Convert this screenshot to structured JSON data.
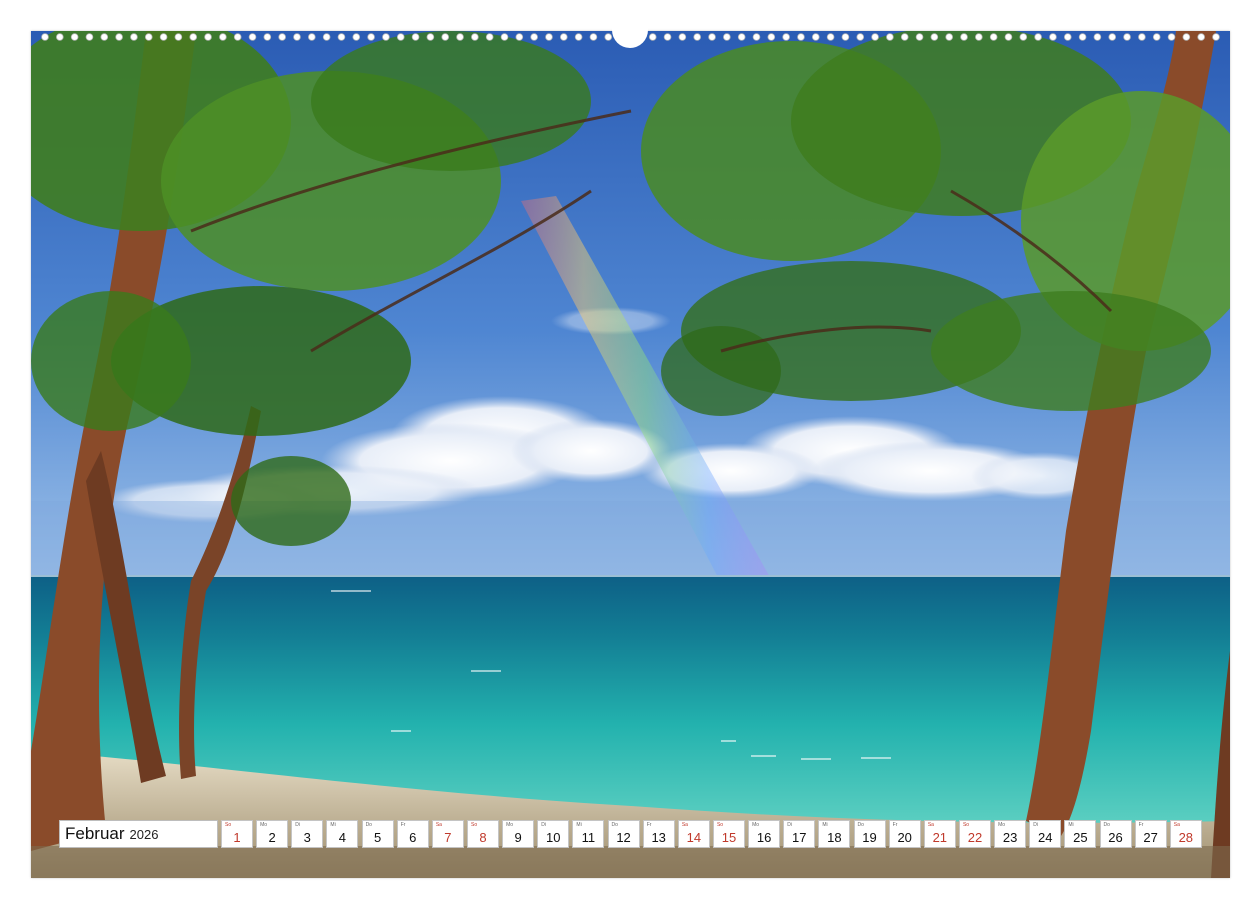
{
  "calendar": {
    "month": "Februar",
    "year": "2026",
    "weekend_color": "#c0392b",
    "days": [
      {
        "abbr": "So",
        "num": "1",
        "weekend": true
      },
      {
        "abbr": "Mo",
        "num": "2",
        "weekend": false
      },
      {
        "abbr": "Di",
        "num": "3",
        "weekend": false
      },
      {
        "abbr": "Mi",
        "num": "4",
        "weekend": false
      },
      {
        "abbr": "Do",
        "num": "5",
        "weekend": false
      },
      {
        "abbr": "Fr",
        "num": "6",
        "weekend": false
      },
      {
        "abbr": "Sa",
        "num": "7",
        "weekend": true
      },
      {
        "abbr": "So",
        "num": "8",
        "weekend": true
      },
      {
        "abbr": "Mo",
        "num": "9",
        "weekend": false
      },
      {
        "abbr": "Di",
        "num": "10",
        "weekend": false
      },
      {
        "abbr": "Mi",
        "num": "11",
        "weekend": false
      },
      {
        "abbr": "Do",
        "num": "12",
        "weekend": false
      },
      {
        "abbr": "Fr",
        "num": "13",
        "weekend": false
      },
      {
        "abbr": "Sa",
        "num": "14",
        "weekend": true
      },
      {
        "abbr": "So",
        "num": "15",
        "weekend": true
      },
      {
        "abbr": "Mo",
        "num": "16",
        "weekend": false
      },
      {
        "abbr": "Di",
        "num": "17",
        "weekend": false
      },
      {
        "abbr": "Mi",
        "num": "18",
        "weekend": false
      },
      {
        "abbr": "Do",
        "num": "19",
        "weekend": false
      },
      {
        "abbr": "Fr",
        "num": "20",
        "weekend": false
      },
      {
        "abbr": "Sa",
        "num": "21",
        "weekend": true
      },
      {
        "abbr": "So",
        "num": "22",
        "weekend": true
      },
      {
        "abbr": "Mo",
        "num": "23",
        "weekend": false
      },
      {
        "abbr": "Di",
        "num": "24",
        "weekend": false
      },
      {
        "abbr": "Mi",
        "num": "25",
        "weekend": false
      },
      {
        "abbr": "Do",
        "num": "26",
        "weekend": false
      },
      {
        "abbr": "Fr",
        "num": "27",
        "weekend": false
      },
      {
        "abbr": "Sa",
        "num": "28",
        "weekend": true
      }
    ]
  },
  "photo": {
    "subject": "tropical-beach-rainbow",
    "colors": {
      "sky_top": "#2d5fb8",
      "sky_mid": "#5b8fd6",
      "sea_deep": "#0f6f8a",
      "sea_turquoise": "#22b3b0",
      "sand": "#d9cfb6",
      "foliage": "#3f7d1f",
      "trunk": "#8a4b2a"
    }
  },
  "binding": {
    "hole_count": 80
  }
}
